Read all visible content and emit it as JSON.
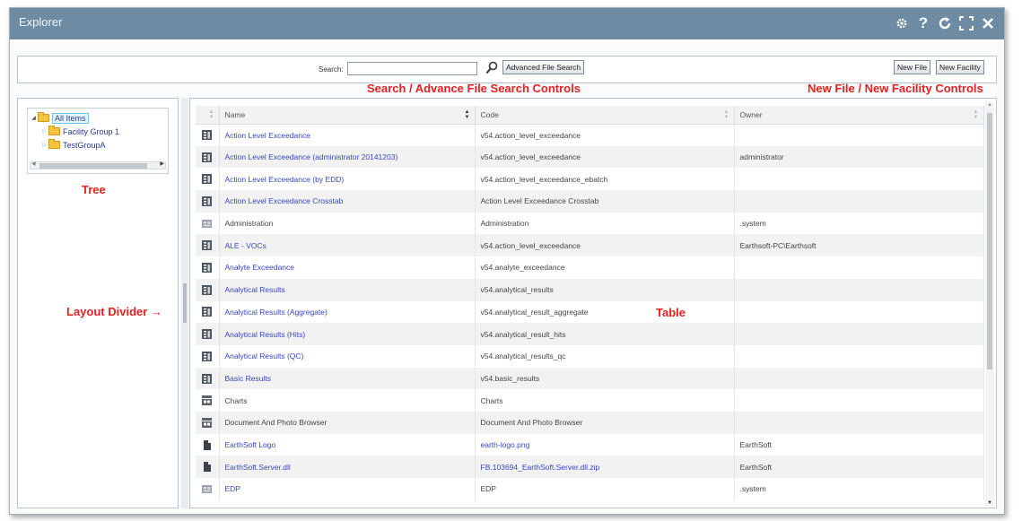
{
  "window": {
    "title": "Explorer"
  },
  "titlebar_icons": [
    "gear-icon",
    "help-icon",
    "refresh-icon",
    "fullscreen-icon",
    "close-icon"
  ],
  "search": {
    "label": "Search:",
    "value": "",
    "advanced_button": "Advanced File Search"
  },
  "actions": {
    "new_file": "New File",
    "new_facility": "New Facility"
  },
  "annotations": {
    "search": "Search / Advance File Search Controls",
    "new_controls": "New File / New Facility Controls",
    "tree": "Tree",
    "divider": "Layout Divider →",
    "table": "Table"
  },
  "tree": {
    "items": [
      {
        "label": "All Items",
        "expanded": true,
        "selected": true
      },
      {
        "label": "Facility Group 1",
        "expanded": false
      },
      {
        "label": "TestGroupA",
        "expanded": false
      }
    ]
  },
  "table": {
    "columns": [
      "Name",
      "Code",
      "Owner"
    ],
    "rows": [
      {
        "icon": "report-icon",
        "name": "Action Level Exceedance",
        "code": "v54.action_level_exceedance",
        "owner": "",
        "link": true,
        "code_link": false
      },
      {
        "icon": "report-icon",
        "name": "Action Level Exceedance (administrator 20141203)",
        "code": "v54.action_level_exceedance",
        "owner": "administrator",
        "link": true,
        "code_link": false
      },
      {
        "icon": "report-icon",
        "name": "Action Level Exceedance (by EDD)",
        "code": "v54.action_level_exceedance_ebatch",
        "owner": "",
        "link": true,
        "code_link": false
      },
      {
        "icon": "report-icon",
        "name": "Action Level Exceedance Crosstab",
        "code": "Action Level Exceedance Crosstab",
        "owner": "",
        "link": true,
        "code_link": false
      },
      {
        "icon": "widget-icon",
        "name": "Administration",
        "code": "Administration",
        "owner": ".system",
        "link": false,
        "code_link": false
      },
      {
        "icon": "report-icon",
        "name": "ALE - VOCs",
        "code": "v54.action_level_exceedance",
        "owner": "Earthsoft-PC\\Earthsoft",
        "link": true,
        "code_link": false
      },
      {
        "icon": "report-icon",
        "name": "Analyte Exceedance",
        "code": "v54.analyte_exceedance",
        "owner": "",
        "link": true,
        "code_link": false
      },
      {
        "icon": "report-icon",
        "name": "Analytical Results",
        "code": "v54.analytical_results",
        "owner": "",
        "link": true,
        "code_link": false
      },
      {
        "icon": "report-icon",
        "name": "Analytical Results (Aggregate)",
        "code": "v54.analytical_result_aggregate",
        "owner": "",
        "link": true,
        "code_link": false
      },
      {
        "icon": "report-icon",
        "name": "Analytical Results (Hits)",
        "code": "v54.analytical_result_hits",
        "owner": "",
        "link": true,
        "code_link": false
      },
      {
        "icon": "report-icon",
        "name": "Analytical Results (QC)",
        "code": "v54.analytical_results_qc",
        "owner": "",
        "link": true,
        "code_link": false
      },
      {
        "icon": "report-icon",
        "name": "Basic Results",
        "code": "v54.basic_results",
        "owner": "",
        "link": true,
        "code_link": false
      },
      {
        "icon": "widget-icon-dark",
        "name": "Charts",
        "code": "Charts",
        "owner": "",
        "link": false,
        "code_link": false
      },
      {
        "icon": "widget-icon-dark",
        "name": "Document And Photo Browser",
        "code": "Document And Photo Browser",
        "owner": "",
        "link": false,
        "code_link": false
      },
      {
        "icon": "file-icon",
        "name": "EarthSoft Logo",
        "code": "earth-logo.png",
        "owner": "EarthSoft",
        "link": true,
        "code_link": true
      },
      {
        "icon": "file-icon",
        "name": "EarthSoft.Server.dll",
        "code": "FB.103694_EarthSoft.Server.dll.zip",
        "owner": "EarthSoft",
        "link": true,
        "code_link": true
      },
      {
        "icon": "widget-icon",
        "name": "EDP",
        "code": "EDP",
        "owner": ".system",
        "link": true,
        "code_link": false
      }
    ]
  }
}
